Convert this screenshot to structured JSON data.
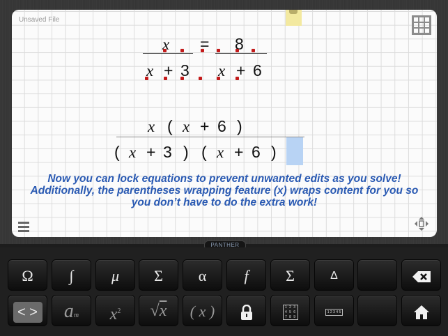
{
  "document": {
    "file_name": "Unsaved File"
  },
  "equation_top": {
    "numerator_left": "x",
    "equals": "=",
    "numerator_right": "8",
    "den_left_var": "x",
    "den_left_op": "+",
    "den_left_num": "3",
    "den_right_var": "x",
    "den_right_op": "+",
    "den_right_num": "6"
  },
  "equation_bottom": {
    "row1": {
      "var1": "x",
      "open": "(",
      "var2": "x",
      "op": "+",
      "num": "6",
      "close": ")"
    },
    "row2": {
      "open1": "(",
      "var1": "x",
      "op1": "+",
      "num1": "3",
      "close1": ")",
      "open2": "(",
      "var2": "x",
      "op2": "+",
      "num2": "6",
      "close2": ")"
    }
  },
  "info_text": "Now you can lock equations to prevent unwanted edits as you solve! Additionally, the parentheses wrapping feature (x) wraps content for you so you don’t have to do the extra work!",
  "keyboard_label": "PANTHER",
  "keyboard": {
    "row1": [
      "Ω",
      "∫",
      "μ",
      "Σ",
      "α",
      "f",
      "Σ",
      "Δ",
      "",
      "⌫"
    ],
    "row2": {
      "cursor_keys": "< >",
      "subscript_base": "a",
      "subscript_sub": "m",
      "power_base": "x",
      "power_exp": "2",
      "sqrt_sign": "√",
      "sqrt_var": "x",
      "paren_wrap": "( x )",
      "numpad_digits": "1 2 3 4 5 6 7 8 9",
      "number_line": "1 2 3 4 5",
      "empty": ""
    }
  },
  "colors": {
    "info_text": "#2a5ab3",
    "lock_marker": "#c31a1a",
    "cursor_cell": "#b8d3f4",
    "note_tab": "#f3e9a0"
  },
  "icons": [
    "grid-view-icon",
    "menu-icon",
    "move-icon",
    "lock-icon",
    "numpad-icon",
    "number-line-icon",
    "backspace-icon",
    "home-icon"
  ]
}
